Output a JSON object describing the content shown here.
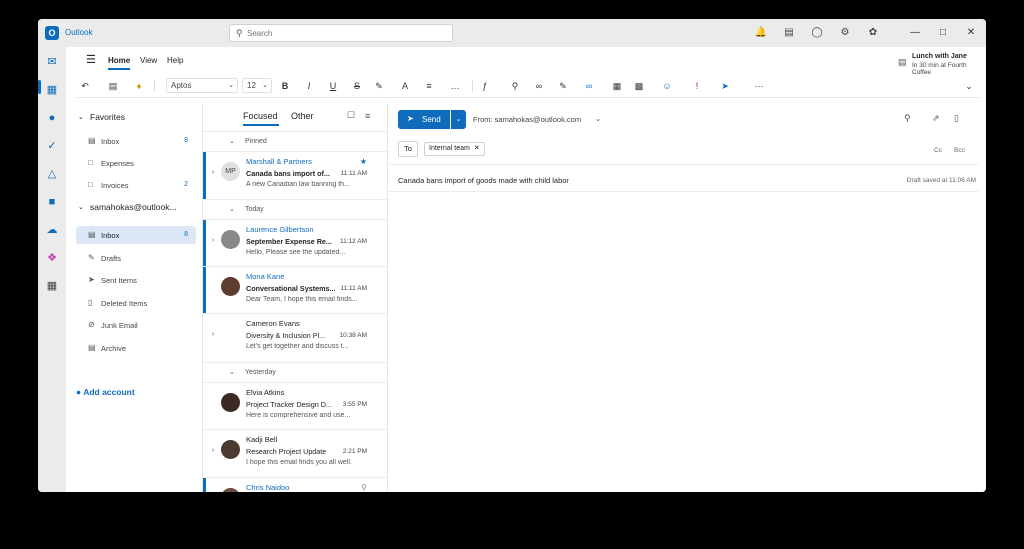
{
  "app": {
    "title": "Outlook"
  },
  "search": {
    "placeholder": "Search"
  },
  "colors": {
    "accent": "#0f6cbd",
    "selected_bg": "#dce8f7",
    "chrome": "#ebebeb"
  },
  "menu": {
    "home": "Home",
    "view": "View",
    "help": "Help"
  },
  "reminder": {
    "title": "Lunch with Jane",
    "subtitle": "In 30 min at Fourth Coffee"
  },
  "ribbon": {
    "font": "Aptos",
    "size": "12",
    "bold": "B",
    "italic": "I",
    "underline": "U",
    "strike": "S"
  },
  "folders": {
    "favorites_label": "Favorites",
    "favorites": [
      {
        "label": "Inbox",
        "count": "8"
      },
      {
        "label": "Expenses",
        "count": ""
      },
      {
        "label": "Invoices",
        "count": "2"
      }
    ],
    "account_label": "samahokas@outlook...",
    "account_items": [
      {
        "label": "Inbox",
        "count": "8"
      },
      {
        "label": "Drafts",
        "count": ""
      },
      {
        "label": "Sent Items",
        "count": ""
      },
      {
        "label": "Deleted Items",
        "count": ""
      },
      {
        "label": "Junk Email",
        "count": ""
      },
      {
        "label": "Archive",
        "count": ""
      }
    ],
    "add_account": "Add account"
  },
  "list": {
    "tab_focused": "Focused",
    "tab_other": "Other",
    "groups": {
      "pinned": "Pinned",
      "today": "Today",
      "yesterday": "Yesterday"
    },
    "messages": [
      {
        "sender": "Marshall & Partners",
        "initials": "MP",
        "subject": "Canada bans import of...",
        "time": "11:11 AM",
        "preview": "A new Canadian law banning th..."
      },
      {
        "sender": "Laurence Gilbertson",
        "subject": "September Expense Re...",
        "time": "11:12 AM",
        "preview": "Hello, Please see the updated..."
      },
      {
        "sender": "Mona Kane",
        "subject": "Conversational Systems...",
        "time": "11:11 AM",
        "preview": "Dear Team, I hope this email finds..."
      },
      {
        "sender": "Cameron Evans",
        "subject": "Diversity & Inclusion Pl...",
        "time": "10:38 AM",
        "preview": "Let's get together and discuss t..."
      },
      {
        "sender": "Elvia Atkins",
        "subject": "Project Tracker Design D...",
        "time": "3:55 PM",
        "preview": "Here is comprehensive and use..."
      },
      {
        "sender": "Kadji Bell",
        "subject": "Research Project Update",
        "time": "2:21 PM",
        "preview": "I hope this email finds you all well."
      },
      {
        "sender": "Chris Naidoo",
        "subject": "",
        "time": "",
        "preview": ""
      }
    ]
  },
  "compose": {
    "send": "Send",
    "from": "From: samahokas@outlook.com",
    "to": "To",
    "recipient": "Internal team",
    "cc": "Cc",
    "bcc": "Bcc",
    "subject": "Canada bans import of goods made with child labor",
    "draft_status": "Draft saved at 11:06 AM"
  }
}
